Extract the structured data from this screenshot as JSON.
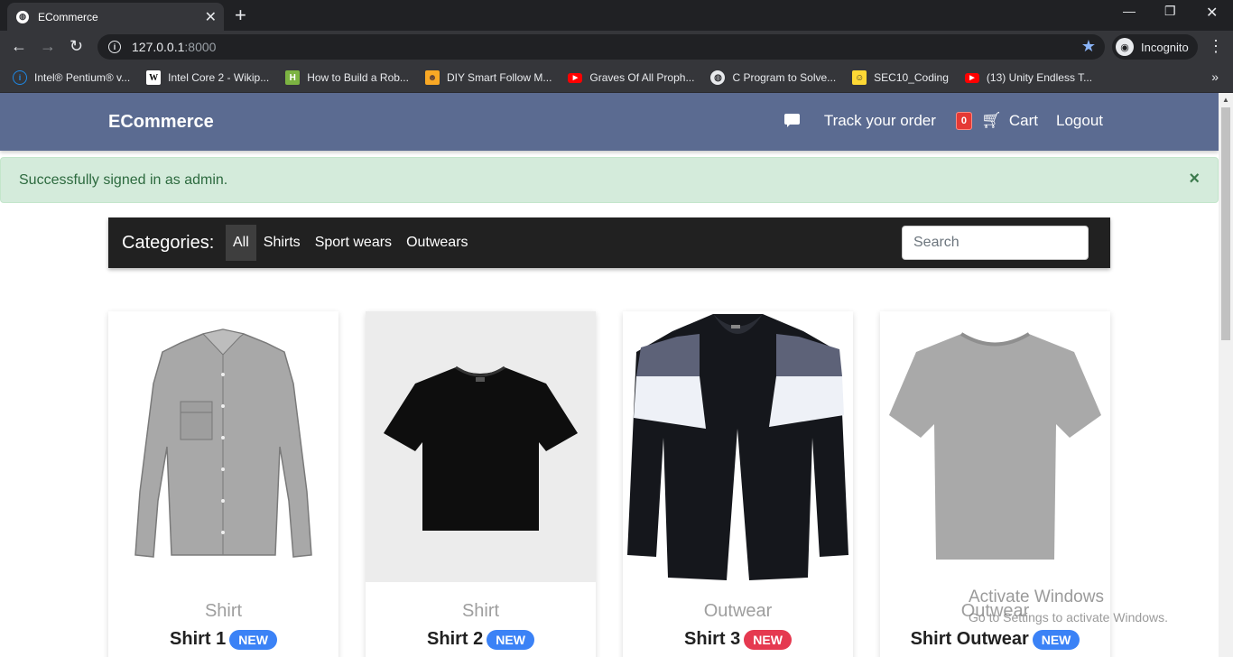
{
  "browser": {
    "tab_title": "ECommerce",
    "tab_close": "✕",
    "new_tab": "+",
    "url_host": "127.0.0.1",
    "url_port": ":8000",
    "profile": "Incognito",
    "bookmarks": [
      {
        "label": "Intel® Pentium® v...",
        "icon": "intel",
        "color": "#1e88e5"
      },
      {
        "label": "Intel Core 2 - Wikip...",
        "icon": "W",
        "color": "#ffffff"
      },
      {
        "label": "How to Build a Rob...",
        "icon": "H",
        "color": "#7cb342"
      },
      {
        "label": "DIY Smart Follow M...",
        "icon": "diy",
        "color": "#f9a825"
      },
      {
        "label": "Graves Of All Proph...",
        "icon": "youtube",
        "color": "#ff0000"
      },
      {
        "label": "C Program to Solve...",
        "icon": "globe",
        "color": "#e8eaed"
      },
      {
        "label": "SEC10_Coding",
        "icon": "smiley",
        "color": "#fdd835"
      },
      {
        "label": "(13) Unity Endless T...",
        "icon": "youtube",
        "color": "#ff0000"
      }
    ]
  },
  "navbar": {
    "brand": "ECommerce",
    "track_label": "Track your order",
    "cart_count": "0",
    "cart_label": "Cart",
    "logout_label": "Logout",
    "color": "#5b6b91"
  },
  "alert": {
    "message": "Successfully signed in as admin.",
    "close": "×"
  },
  "categories": {
    "label": "Categories:",
    "items": [
      "All",
      "Shirts",
      "Sport wears",
      "Outwears"
    ],
    "active": "All",
    "search_placeholder": "Search"
  },
  "products": [
    {
      "category": "Shirt",
      "name": "Shirt 1",
      "badge": "NEW",
      "badge_color": "#3b82f6"
    },
    {
      "category": "Shirt",
      "name": "Shirt 2",
      "badge": "NEW",
      "badge_color": "#3b82f6"
    },
    {
      "category": "Outwear",
      "name": "Shirt 3",
      "badge": "NEW",
      "badge_color": "#e53950"
    },
    {
      "category": "Outwear",
      "name": "Shirt Outwear",
      "badge": "NEW",
      "badge_color": "#3b82f6"
    }
  ],
  "watermark": {
    "title": "Activate Windows",
    "subtitle": "Go to Settings to activate Windows."
  }
}
